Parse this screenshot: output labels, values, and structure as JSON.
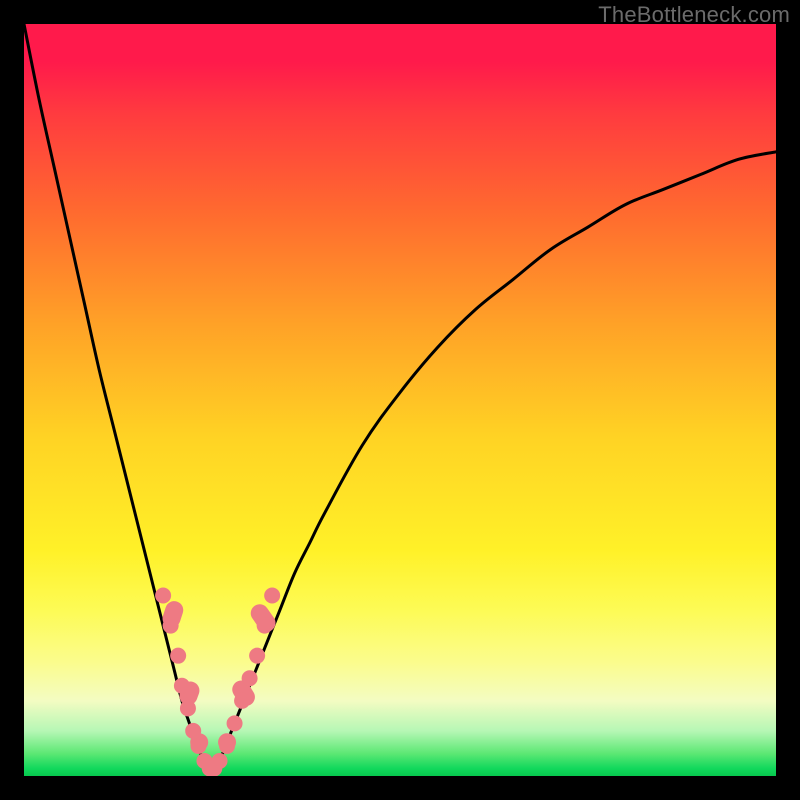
{
  "watermark": "TheBottleneck.com",
  "colors": {
    "frame": "#000000",
    "curve": "#000000",
    "marker": "#ee7a83",
    "gradient_top": "#ff1a4b",
    "gradient_bottom": "#07c84e"
  },
  "chart_data": {
    "type": "line",
    "title": "",
    "xlabel": "",
    "ylabel": "",
    "xlim": [
      0,
      100
    ],
    "ylim": [
      0,
      100
    ],
    "grid": false,
    "legend": false,
    "note": "Axes unlabeled in source image; values estimated from position as percent of plot area (0=left/bottom, 100=right/top).",
    "series": [
      {
        "name": "left-branch",
        "x": [
          0,
          2,
          4,
          6,
          8,
          10,
          12,
          14,
          16,
          18,
          19,
          20,
          21,
          22,
          23,
          24,
          25
        ],
        "y": [
          100,
          90,
          81,
          72,
          63,
          54,
          46,
          38,
          30,
          22,
          18,
          14,
          10,
          7,
          4,
          2,
          0
        ]
      },
      {
        "name": "right-branch",
        "x": [
          25,
          26,
          28,
          30,
          32,
          34,
          36,
          38,
          40,
          45,
          50,
          55,
          60,
          65,
          70,
          75,
          80,
          85,
          90,
          95,
          100
        ],
        "y": [
          0,
          2,
          7,
          12,
          17,
          22,
          27,
          31,
          35,
          44,
          51,
          57,
          62,
          66,
          70,
          73,
          76,
          78,
          80,
          82,
          83
        ]
      }
    ],
    "markers": {
      "name": "highlighted-points",
      "shape": "circle",
      "color": "#ee7a83",
      "points": [
        {
          "x": 18.5,
          "y": 24
        },
        {
          "x": 19.5,
          "y": 20
        },
        {
          "x": 20.5,
          "y": 16
        },
        {
          "x": 21.0,
          "y": 12
        },
        {
          "x": 21.8,
          "y": 9
        },
        {
          "x": 22.5,
          "y": 6
        },
        {
          "x": 23.2,
          "y": 4
        },
        {
          "x": 24.0,
          "y": 2
        },
        {
          "x": 24.7,
          "y": 1
        },
        {
          "x": 25.3,
          "y": 1
        },
        {
          "x": 26.0,
          "y": 2
        },
        {
          "x": 27.0,
          "y": 4
        },
        {
          "x": 28.0,
          "y": 7
        },
        {
          "x": 29.0,
          "y": 10
        },
        {
          "x": 30.0,
          "y": 13
        },
        {
          "x": 31.0,
          "y": 16
        },
        {
          "x": 32.0,
          "y": 20
        },
        {
          "x": 33.0,
          "y": 24
        }
      ]
    },
    "marker_pills": [
      {
        "cx": 19.8,
        "cy": 21.5,
        "angle": -72,
        "len": 9
      },
      {
        "cx": 22.0,
        "cy": 11.0,
        "angle": -70,
        "len": 8
      },
      {
        "cx": 23.3,
        "cy": 4.5,
        "angle": -65,
        "len": 6
      },
      {
        "cx": 25.0,
        "cy": 1.0,
        "angle": 0,
        "len": 6
      },
      {
        "cx": 27.0,
        "cy": 4.5,
        "angle": 60,
        "len": 6
      },
      {
        "cx": 29.2,
        "cy": 11.0,
        "angle": 58,
        "len": 9
      },
      {
        "cx": 31.8,
        "cy": 21.0,
        "angle": 55,
        "len": 10
      }
    ]
  }
}
